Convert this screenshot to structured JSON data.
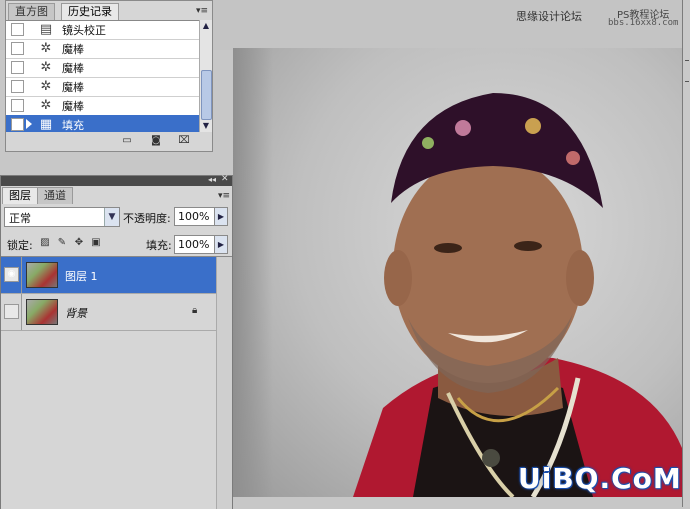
{
  "watermark": {
    "top_text": "思缘设计论坛",
    "ps_text": "PS教程论坛",
    "url_text": "bbs.16xx8.com",
    "bottom_text": "UiBQ.CoM"
  },
  "history_panel": {
    "tabs": [
      "直方图",
      "历史记录"
    ],
    "active_tab": "历史记录",
    "menu_icon": "panel-menu-icon",
    "items": [
      {
        "label": "镜头校正",
        "icon": "lens-correction-icon",
        "selected": false
      },
      {
        "label": "魔棒",
        "icon": "magic-wand-icon",
        "selected": false
      },
      {
        "label": "魔棒",
        "icon": "magic-wand-icon",
        "selected": false
      },
      {
        "label": "魔棒",
        "icon": "magic-wand-icon",
        "selected": false
      },
      {
        "label": "魔棒",
        "icon": "magic-wand-icon",
        "selected": false
      },
      {
        "label": "填充",
        "icon": "fill-icon",
        "selected": true
      }
    ],
    "footer_icons": [
      "new-document-from-state-icon",
      "snapshot-camera-icon",
      "trash-icon"
    ]
  },
  "layers_panel": {
    "tabs": [
      "图层",
      "通道"
    ],
    "active_tab": "图层",
    "blend_mode": "正常",
    "opacity_label": "不透明度:",
    "opacity_value": "100%",
    "lock_label": "锁定:",
    "fill_label": "填充:",
    "fill_value": "100%",
    "layers": [
      {
        "name": "图层 1",
        "visible": true,
        "selected": true,
        "locked": false
      },
      {
        "name": "背景",
        "visible": false,
        "selected": false,
        "locked": true
      }
    ]
  }
}
